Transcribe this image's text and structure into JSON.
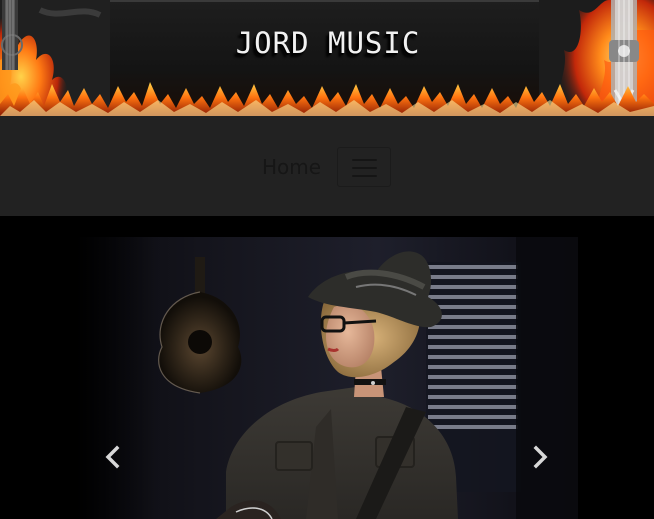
{
  "header": {
    "title": "JORD MUSIC"
  },
  "nav": {
    "home_label": "Home",
    "toggler_icon": "hamburger-menu-icon"
  },
  "carousel": {
    "prev_icon": "chevron-left-icon",
    "next_icon": "chevron-right-icon"
  },
  "colors": {
    "navbar_bg": "#222222",
    "banner_bg": "#1a1a1a",
    "page_bg": "#000000",
    "title_text": "#f2f2f2"
  }
}
